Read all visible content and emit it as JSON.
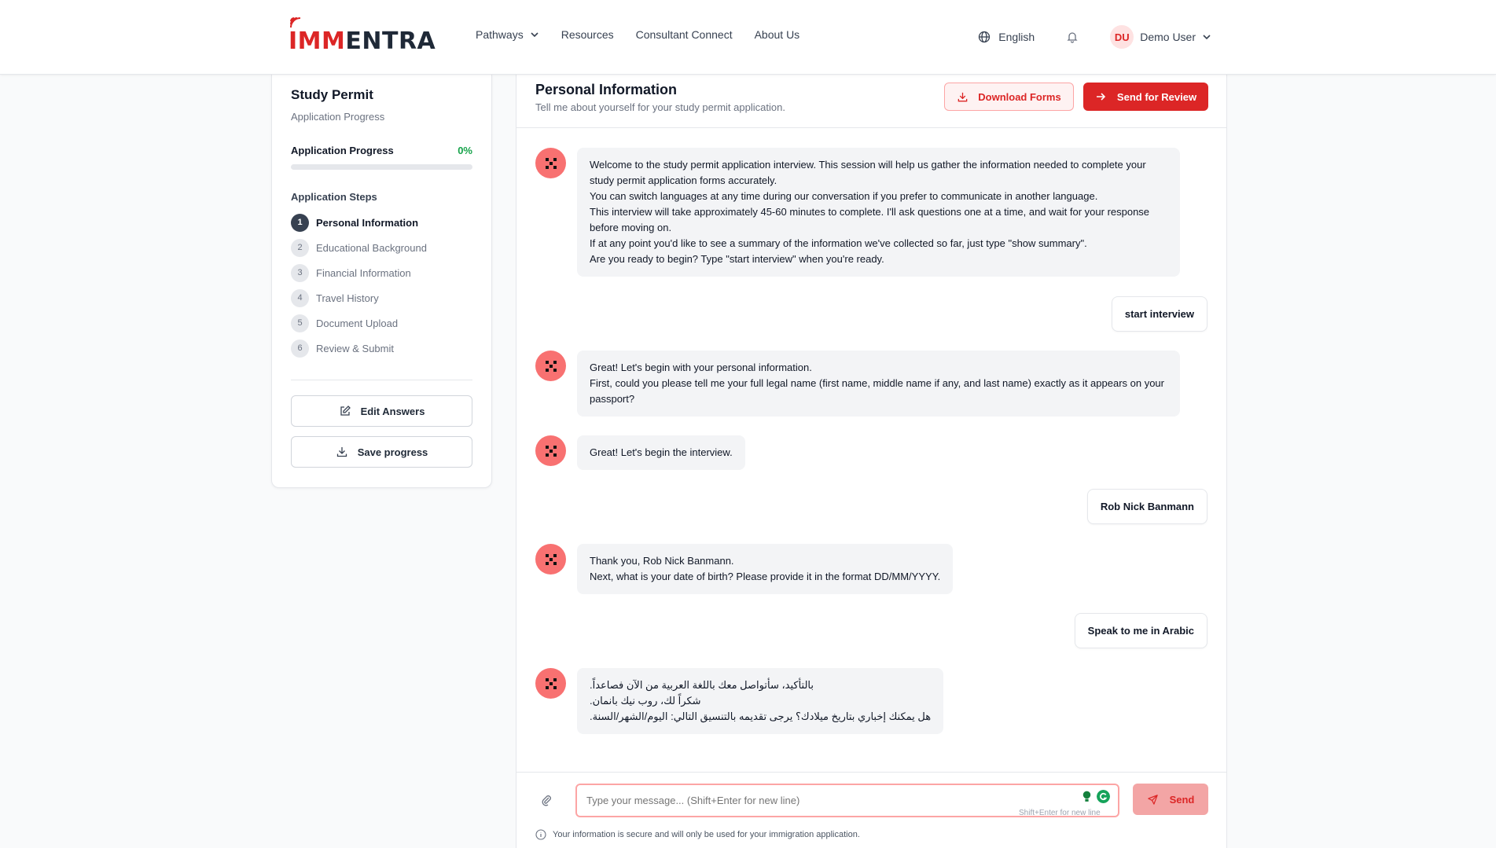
{
  "brand": {
    "left": "IMM",
    "right": "ENTRA",
    "accent": "#dc2626",
    "dark": "#1f2937"
  },
  "nav": {
    "pathways": "Pathways",
    "resources": "Resources",
    "consultant": "Consultant Connect",
    "about": "About Us"
  },
  "header": {
    "language": "English",
    "avatar_initials": "DU",
    "user_name": "Demo User"
  },
  "sidebar": {
    "title": "Study Permit",
    "subtitle": "Application Progress",
    "progress_label": "Application Progress",
    "progress_value": "0%",
    "progress_fraction": 0,
    "steps_title": "Application Steps",
    "steps": [
      {
        "num": "1",
        "label": "Personal Information"
      },
      {
        "num": "2",
        "label": "Educational Background"
      },
      {
        "num": "3",
        "label": "Financial Information"
      },
      {
        "num": "4",
        "label": "Travel History"
      },
      {
        "num": "5",
        "label": "Document Upload"
      },
      {
        "num": "6",
        "label": "Review & Submit"
      }
    ],
    "edit_label": "Edit Answers",
    "save_label": "Save progress"
  },
  "main": {
    "title": "Personal Information",
    "subtitle": "Tell me about yourself for your study permit application.",
    "download_label": "Download Forms",
    "review_label": "Send for Review"
  },
  "messages": [
    {
      "role": "bot",
      "lines": [
        "Welcome to the study permit application interview. This session will help us gather the information needed to complete your study permit application forms accurately.",
        "You can switch languages at any time during our conversation if you prefer to communicate in another language.",
        "This interview will take approximately 45-60 minutes to complete. I'll ask questions one at a time, and wait for your response before moving on.",
        "If at any point you'd like to see a summary of the information we've collected so far, just type \"show summary\".",
        "Are you ready to begin? Type \"start interview\" when you're ready."
      ]
    },
    {
      "role": "user",
      "text": "start interview"
    },
    {
      "role": "bot",
      "lines": [
        "Great! Let's begin with your personal information.",
        "First, could you please tell me your full legal name (first name, middle name if any, and last name) exactly as it appears on your passport?"
      ]
    },
    {
      "role": "bot",
      "lines": [
        "Great! Let's begin the interview."
      ]
    },
    {
      "role": "user",
      "text": "Rob Nick Banmann"
    },
    {
      "role": "bot",
      "lines": [
        "Thank you, Rob Nick Banmann.",
        "Next, what is your date of birth? Please provide it in the format DD/MM/YYYY."
      ]
    },
    {
      "role": "user",
      "text": "Speak to me in Arabic"
    },
    {
      "role": "bot",
      "lines": [
        "بالتأكيد، سأتواصل معك باللغة العربية من الآن فصاعداً.",
        "شكراً لك، روب نيك بانمان.",
        "هل يمكنك إخباري بتاريخ ميلادك؟ يرجى تقديمه بالتنسيق التالي: اليوم/الشهر/السنة."
      ]
    }
  ],
  "composer": {
    "placeholder": "Type your message... (Shift+Enter for new line)",
    "hint": "Shift+Enter for new line",
    "send_label": "Send",
    "secure_note": "Your information is secure and will only be used for your immigration application."
  }
}
